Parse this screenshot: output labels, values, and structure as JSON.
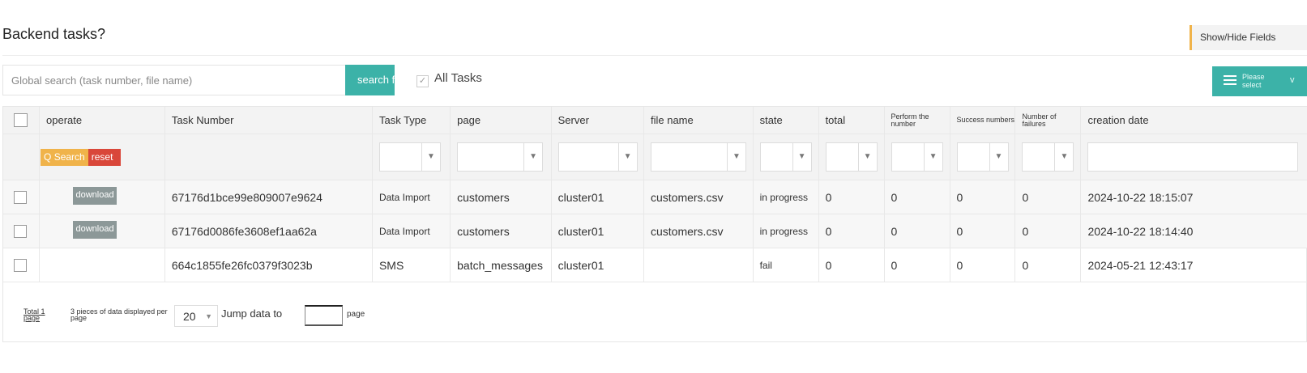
{
  "page": {
    "title": "Backend tasks?",
    "show_hide_label": "Show/Hide Fields"
  },
  "toolbar": {
    "search_placeholder": "Global search (task number, file name)",
    "search_button": "search f",
    "all_tasks_label": "All Tasks",
    "all_tasks_check": "✓",
    "please_select": "Please select",
    "please_select_short": "v"
  },
  "table": {
    "columns": [
      "operate",
      "Task Number",
      "Task Type",
      "page",
      "Server",
      "file name",
      "state",
      "total",
      "Perform the number",
      "Success numbers",
      "Number of failures",
      "creation date"
    ],
    "filter_buttons": {
      "search": "Q Search",
      "reset": "reset"
    },
    "rows": [
      {
        "download": "download",
        "task_number": "67176d1bce99e809007e9624",
        "task_type": "Data Import",
        "page": "customers",
        "server": "cluster01",
        "file_name": "customers.csv",
        "state": "in progress",
        "total": "0",
        "performed": "0",
        "success": "0",
        "failures": "0",
        "created": "2024-10-22 18:15:07"
      },
      {
        "download": "download",
        "task_number": "67176d0086fe3608ef1aa62a",
        "task_type": "Data Import",
        "page": "customers",
        "server": "cluster01",
        "file_name": "customers.csv",
        "state": "in progress",
        "total": "0",
        "performed": "0",
        "success": "0",
        "failures": "0",
        "created": "2024-10-22 18:14:40"
      },
      {
        "download": "",
        "task_number": "664c1855fe26fc0379f3023b",
        "task_type": "SMS",
        "page": "batch_messages",
        "server": "cluster01",
        "file_name": "",
        "state": "fail",
        "total": "0",
        "performed": "0",
        "success": "0",
        "failures": "0",
        "created": "2024-05-21 12:43:17"
      }
    ]
  },
  "pager": {
    "total": "Total 1 page",
    "per_page_desc": "3 pieces of data displayed per page",
    "page_size": "20",
    "jump_label": "Jump data to",
    "page_suffix": "page"
  }
}
